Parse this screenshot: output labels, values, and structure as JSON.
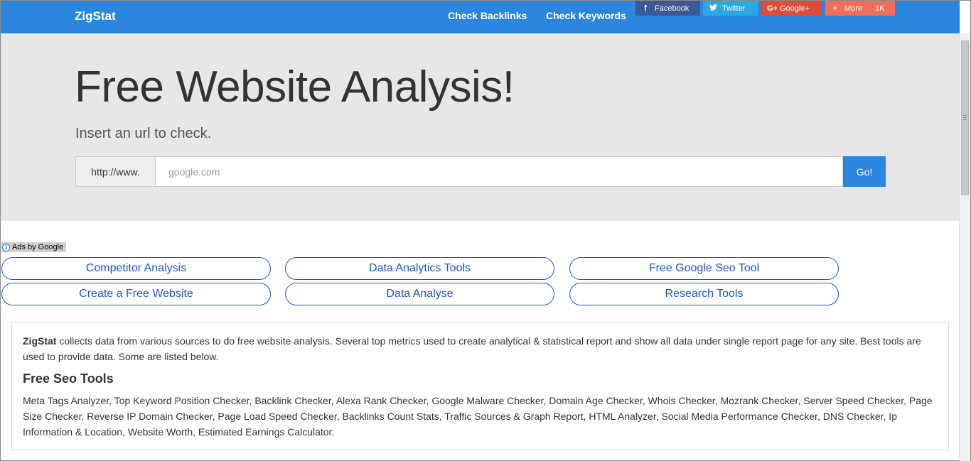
{
  "nav": {
    "brand": "ZigStat",
    "links": [
      "Check Backlinks",
      "Check Keywords"
    ]
  },
  "share": {
    "facebook": {
      "glyph": "f",
      "label": "Facebook",
      "color": "#3b5998"
    },
    "twitter": {
      "label": "Twitter",
      "color": "#2aa9e0"
    },
    "googleplus": {
      "glyph": "G+",
      "label": "Google+",
      "color": "#dd4b39"
    },
    "more": {
      "glyph": "+",
      "label": "More",
      "count": "1K",
      "color": "#f26e5b"
    }
  },
  "hero": {
    "title": "Free Website Analysis!",
    "subtitle": "Insert an url to check.",
    "url_prefix": "http://www.",
    "url_placeholder": "google.com",
    "go_label": "Go!"
  },
  "ads": {
    "label": "Ads by Google",
    "links": [
      "Competitor Analysis",
      "Data Analytics Tools",
      "Free Google Seo Tool",
      "Create a Free Website",
      "Data Analyse",
      "Research Tools"
    ]
  },
  "panel": {
    "brand": "ZigStat",
    "intro": " collects data from various sources to do free website analysis. Several top metrics used to create analytical & statistical report and show all data under single report page for any site. Best tools are used to provide data. Some are listed below.",
    "heading": "Free Seo Tools",
    "tools": "Meta Tags Analyzer, Top Keyword Position Checker, Backlink Checker, Alexa Rank Checker, Google Malware Checker, Domain Age Checker, Whois Checker, Mozrank Checker, Server Speed Checker, Page Size Checker, Reverse IP Domain Checker, Page Load Speed Checker, Backlinks Count Stats, Traffic Sources & Graph Report, HTML Analyzer, Social Media Performance Checker, DNS Checker, Ip Information & Location, Website Worth, Estimated Earnings Calculator."
  },
  "colors": {
    "accent": "#2b86e0",
    "hero_bg": "#e7e7e7",
    "ad_link": "#1a58c7"
  }
}
